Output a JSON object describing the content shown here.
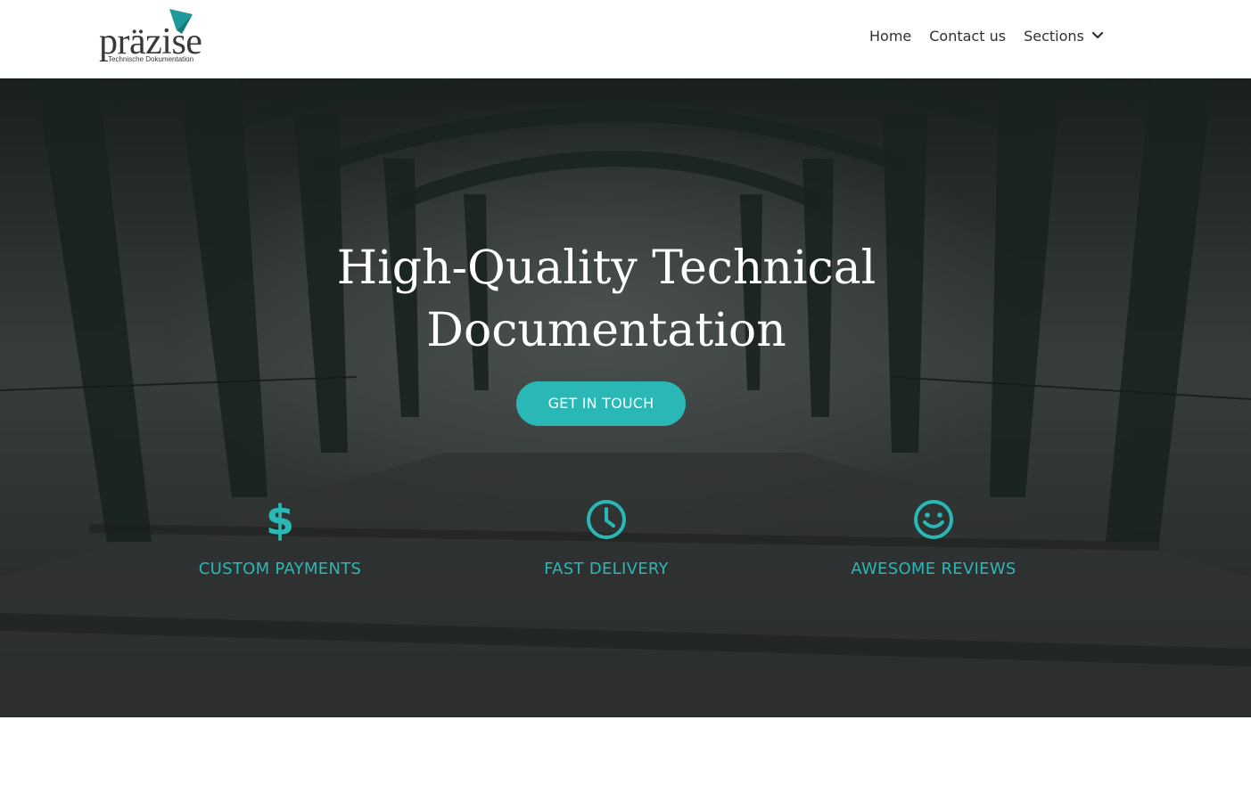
{
  "header": {
    "logo_word": "präzise",
    "logo_tagline": "Technische Dokumentation",
    "nav": [
      {
        "label": "Home"
      },
      {
        "label": "Contact us"
      },
      {
        "label": "Sections"
      }
    ]
  },
  "hero": {
    "title_line1": "High-Quality Technical",
    "title_line2": "Documentation",
    "cta_label": "GET IN TOUCH",
    "features": [
      {
        "icon": "dollar-icon",
        "label": "CUSTOM PAYMENTS"
      },
      {
        "icon": "clock-icon",
        "label": "FAST DELIVERY"
      },
      {
        "icon": "smiley-icon",
        "label": "AWESOME REVIEWS"
      }
    ]
  },
  "colors": {
    "accent": "#2ab8b6",
    "nav_text": "#2e3035",
    "logo_mark": "#1f9a9a"
  }
}
